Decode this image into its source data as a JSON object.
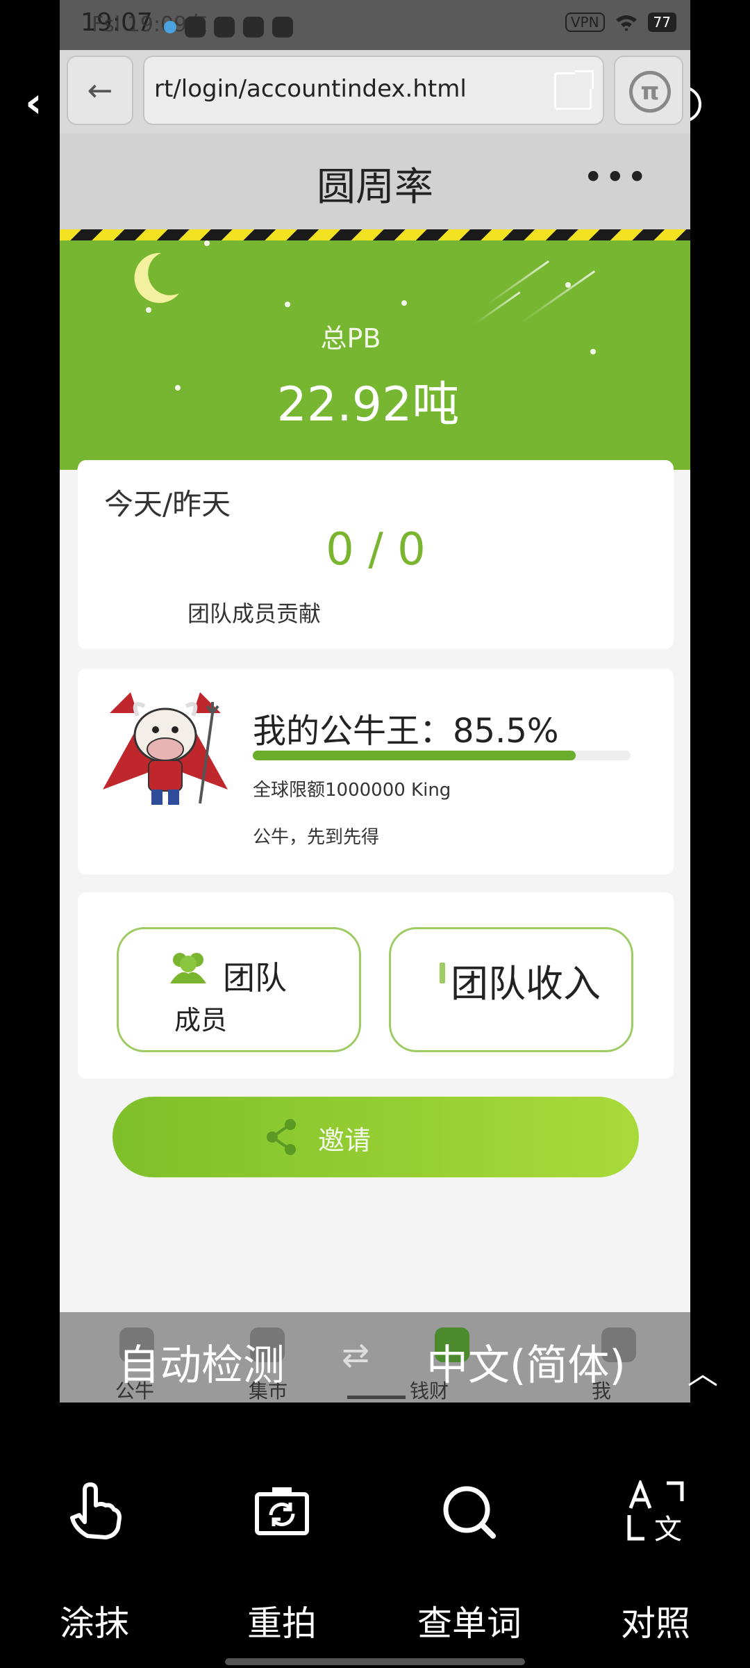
{
  "status_bar": {
    "time": "19:07",
    "ghost_text": "Fsl 19:09东",
    "vpn": "VPN",
    "battery": "77"
  },
  "browser": {
    "back_arrow": "←",
    "url": "rt/login/accountindex.html"
  },
  "page": {
    "title": "圆周率",
    "more": "•••"
  },
  "hero": {
    "label": "总PB",
    "value": "22.92吨",
    "accent": "#76b630"
  },
  "today_card": {
    "heading": "今天/昨天",
    "value": "0 / 0",
    "sub": "团队成员贡献"
  },
  "king_card": {
    "title": "我的公牛王：85.5%",
    "progress": 0.855,
    "limit": "全球限额1000000 King",
    "note": "公牛，先到先得"
  },
  "team_card": {
    "members_l1": "团队",
    "members_l2": "成员",
    "income": "团队收入"
  },
  "invite": {
    "label": "邀请",
    "gradient": [
      "#7fbf2a",
      "#a8db3a"
    ]
  },
  "tabbar": {
    "tabs": [
      "公牛",
      "集市",
      "钱财",
      "我"
    ],
    "active_index": 2
  },
  "translation": {
    "source_lang": "自动检测",
    "swap": "⇄",
    "target_lang": "中文(简体)"
  },
  "toolbar": {
    "items": [
      {
        "label": "涂抹",
        "icon": "hand-pointer-icon"
      },
      {
        "label": "重拍",
        "icon": "camera-retake-icon"
      },
      {
        "label": "查单词",
        "icon": "search-icon"
      },
      {
        "label": "对照",
        "icon": "translate-compare-icon"
      }
    ]
  }
}
